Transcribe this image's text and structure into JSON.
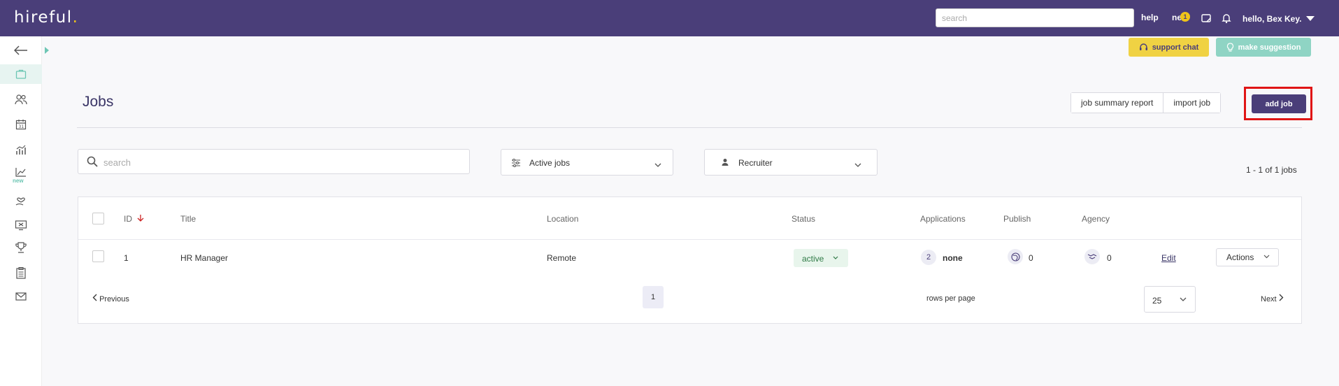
{
  "header": {
    "logo_text": "hireful",
    "logo_dot": ".",
    "search_placeholder": "search",
    "help_label": "help",
    "news_label": "ne",
    "news_badge": "1",
    "user_greeting": "hello, Bex Key."
  },
  "sidebar": {
    "new_label": "new",
    "items": [
      "back-arrow-icon",
      "briefcase-icon",
      "people-icon",
      "calendar-icon",
      "analytics-icon",
      "trend-icon",
      "heart-hand-icon",
      "screen-icon",
      "trophy-icon",
      "clipboard-icon",
      "mail-icon"
    ]
  },
  "topActions": {
    "support_chat": "support chat",
    "make_suggestion": "make suggestion"
  },
  "page": {
    "title": "Jobs",
    "job_summary_report": "job summary report",
    "import_job": "import job",
    "add_job": "add job"
  },
  "filters": {
    "search_placeholder": "search",
    "status_filter": "Active jobs",
    "recruiter_filter": "Recruiter",
    "count": "1 - 1 of 1 jobs"
  },
  "table": {
    "headers": {
      "id": "ID",
      "title": "Title",
      "location": "Location",
      "status": "Status",
      "applications": "Applications",
      "publish": "Publish",
      "agency": "Agency"
    },
    "rows": [
      {
        "id": "1",
        "title": "HR Manager",
        "location": "Remote",
        "status": "active",
        "applications_count": "2",
        "applications_label": "none",
        "publish_count": "0",
        "agency_count": "0",
        "edit": "Edit",
        "actions": "Actions"
      }
    ]
  },
  "pagination": {
    "previous": "Previous",
    "current_page": "1",
    "rows_per_page_label": "rows per page",
    "rows_per_page": "25",
    "next": "Next"
  },
  "colors": {
    "brand_purple": "#4a3e79",
    "accent_yellow": "#f0d243",
    "accent_teal": "#8fd4c4",
    "highlight_red": "#e01515"
  }
}
